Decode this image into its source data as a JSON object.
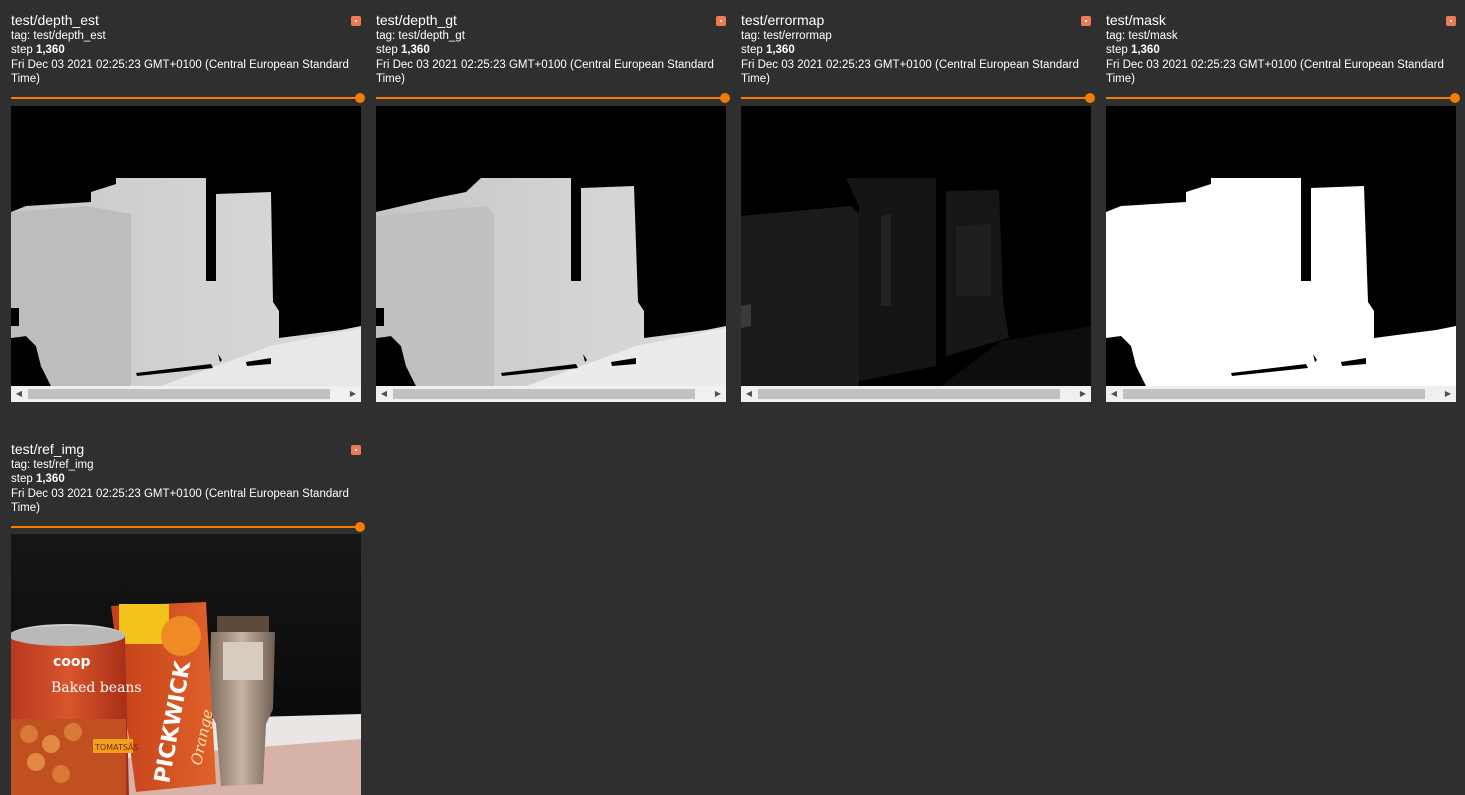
{
  "cards": [
    {
      "title": "test/depth_est",
      "tag_prefix": "tag: ",
      "tag": "test/depth_est",
      "step_prefix": "step ",
      "step": "1,360",
      "date": "Fri Dec 03 2021 02:25:23 GMT+0100 (Central European Standard Time)",
      "image": "depth estimate grayscale"
    },
    {
      "title": "test/depth_gt",
      "tag_prefix": "tag: ",
      "tag": "test/depth_gt",
      "step_prefix": "step ",
      "step": "1,360",
      "date": "Fri Dec 03 2021 02:25:23 GMT+0100 (Central European Standard Time)",
      "image": "depth ground truth grayscale"
    },
    {
      "title": "test/errormap",
      "tag_prefix": "tag: ",
      "tag": "test/errormap",
      "step_prefix": "step ",
      "step": "1,360",
      "date": "Fri Dec 03 2021 02:25:23 GMT+0100 (Central European Standard Time)",
      "image": "error map dark"
    },
    {
      "title": "test/mask",
      "tag_prefix": "tag: ",
      "tag": "test/mask",
      "step_prefix": "step ",
      "step": "1,360",
      "date": "Fri Dec 03 2021 02:25:23 GMT+0100 (Central European Standard Time)",
      "image": "binary mask white"
    },
    {
      "title": "test/ref_img",
      "tag_prefix": "tag: ",
      "tag": "test/ref_img",
      "step_prefix": "step ",
      "step": "1,360",
      "date": "Fri Dec 03 2021 02:25:23 GMT+0100 (Central European Standard Time)",
      "image": "reference photo",
      "photo_text": {
        "can_brand": "coop",
        "can_label": "Baked beans",
        "can_sub": "TOMATSÅS",
        "box_brand": "PICKWICK",
        "box_flavor": "Orange"
      }
    }
  ],
  "colors": {
    "background": "#2f2f2f",
    "accent": "#f57c00",
    "expand_button": "#ef7b52"
  },
  "slider_value": 1.0,
  "icons": {
    "expand": "expand-icon",
    "scroll_left": "arrow-left-icon",
    "scroll_right": "arrow-right-icon"
  }
}
